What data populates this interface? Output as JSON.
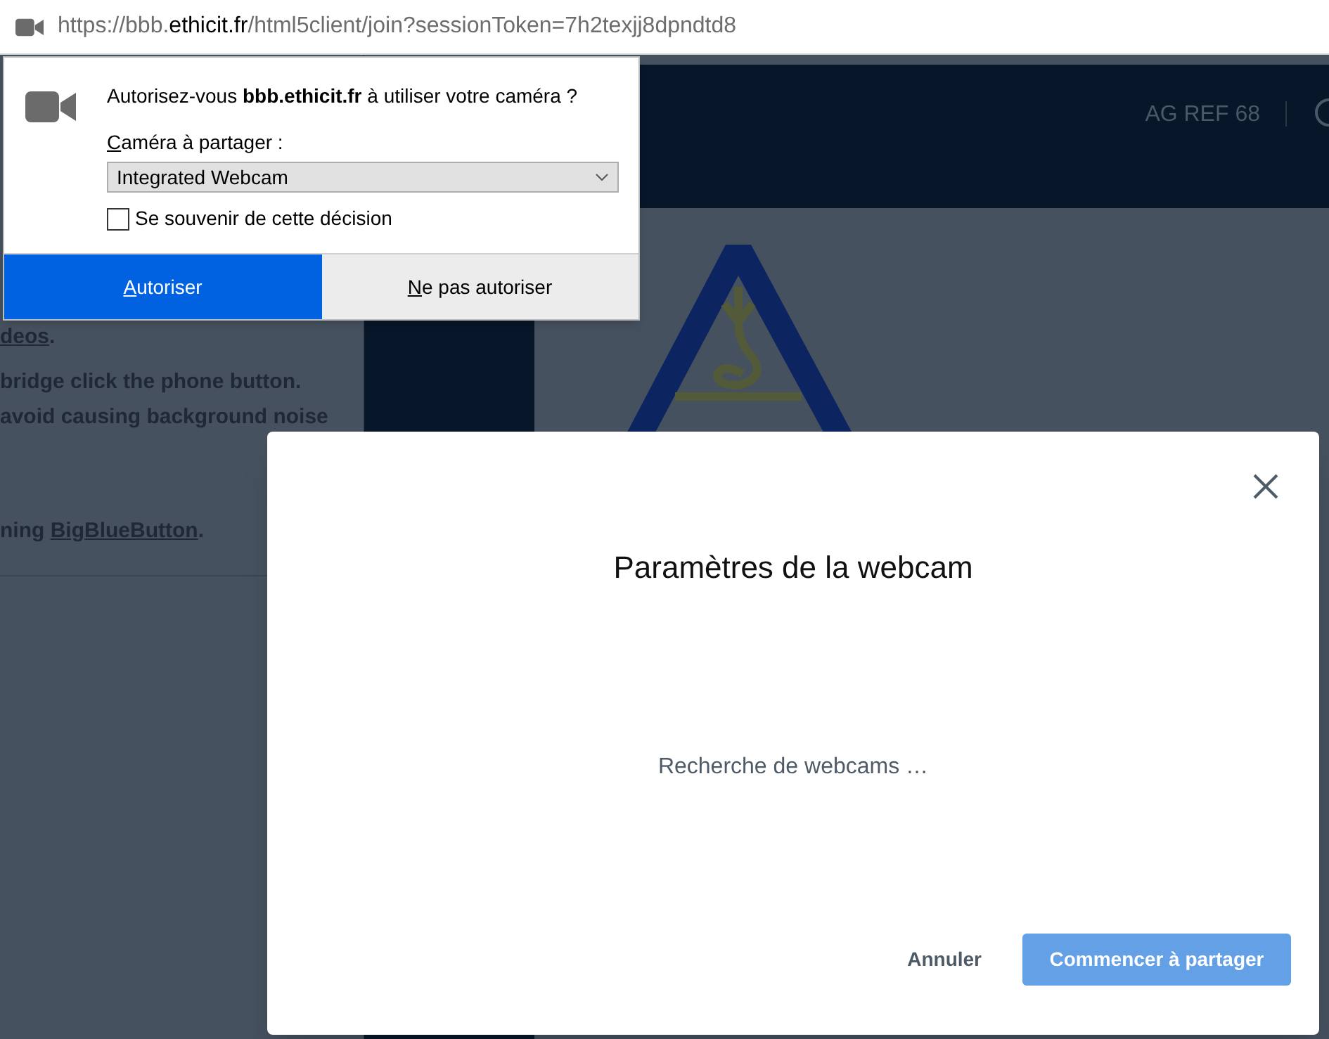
{
  "address_bar": {
    "url_parts": [
      {
        "text": "https://bbb.",
        "emphasis": false
      },
      {
        "text": "ethicit.fr",
        "emphasis": true
      },
      {
        "text": "/html5client/join?sessionToken=7h2texjj8dpndtd8",
        "emphasis": false
      }
    ]
  },
  "permission_popup": {
    "question_parts": [
      {
        "text": "Autorisez-vous ",
        "emphasis": false
      },
      {
        "text": "bbb.ethicit.fr",
        "emphasis": true
      },
      {
        "text": " à utiliser votre caméra ?",
        "emphasis": false
      }
    ],
    "camera_label": {
      "access_key": "C",
      "rest": "améra à partager :"
    },
    "camera_select": {
      "value": "Integrated Webcam"
    },
    "remember": {
      "label": "Se souvenir de cette décision",
      "checked": false
    },
    "buttons": [
      {
        "access_key": "A",
        "rest": "utoriser",
        "kind": "primary"
      },
      {
        "access_key": "N",
        "rest": "e pas autoriser",
        "kind": "secondary"
      }
    ]
  },
  "side_panel": {
    "lines": [
      {
        "parts": [
          {
            "text": "deos",
            "link": true
          },
          {
            "text": ".",
            "link": false
          }
        ]
      },
      {
        "parts": [
          {
            "text": "bridge click the phone button.",
            "link": false
          }
        ]
      },
      {
        "parts": [
          {
            "text": "avoid causing background noise",
            "link": false
          }
        ]
      },
      {
        "parts": [
          {
            "text": "ning ",
            "link": false
          },
          {
            "text": "BigBlueButton",
            "link": true
          },
          {
            "text": ".",
            "link": false
          }
        ]
      }
    ]
  },
  "top_bar": {
    "meeting_name": "AG REF 68"
  },
  "webcam_dialog": {
    "title": "Paramètres de la webcam",
    "status": "Recherche de webcams …",
    "buttons": [
      {
        "label": "Annuler",
        "kind": "secondary"
      },
      {
        "label": "Commencer à partager",
        "kind": "primary"
      }
    ]
  }
}
